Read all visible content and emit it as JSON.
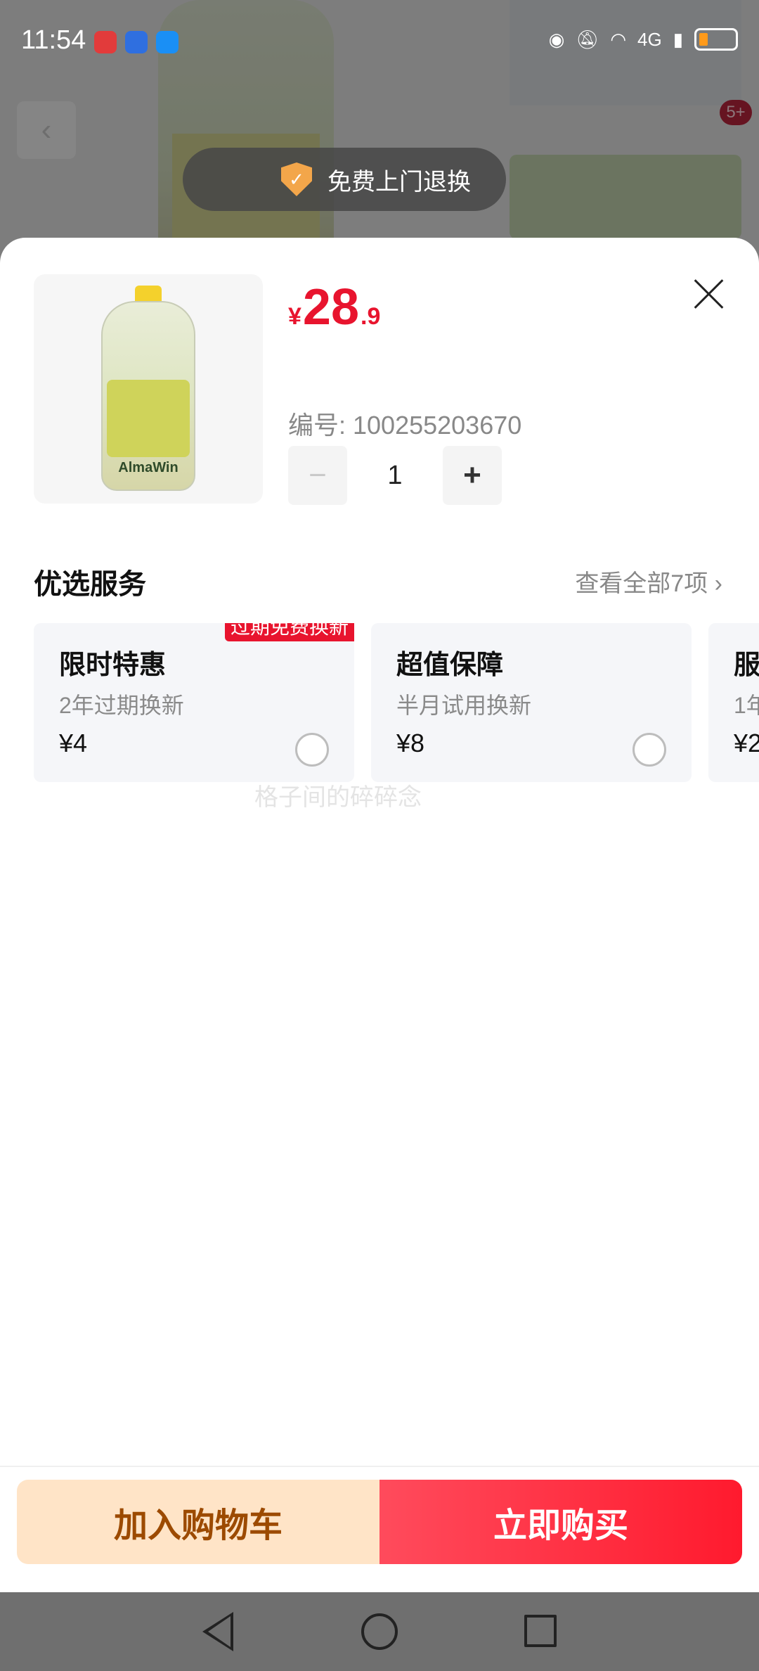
{
  "status_bar": {
    "time": "11:54",
    "network": "4G"
  },
  "background": {
    "banner_text": "免费上门退换",
    "cart_badge": "5+"
  },
  "product": {
    "brand": "AlmaWin",
    "price": {
      "currency": "¥",
      "integer": "28",
      "decimal": ".9"
    },
    "sku_label": "编号: 100255203670",
    "quantity": "1"
  },
  "services": {
    "title": "优选服务",
    "view_all": "查看全部7项 ›",
    "cards": [
      {
        "title": "限时特惠",
        "desc": "2年过期换新",
        "price": "¥4",
        "tag": "过期免费换新"
      },
      {
        "title": "超值保障",
        "desc": "半月试用换新",
        "price": "¥8",
        "tag": ""
      },
      {
        "title": "服",
        "desc": "1年",
        "price": "¥2",
        "tag": ""
      }
    ]
  },
  "watermark": "格子间的碎碎念",
  "actions": {
    "add_to_cart": "加入购物车",
    "buy_now": "立即购买"
  },
  "colors": {
    "price_red": "#e8142e",
    "cart_bg": "#ffe4c7",
    "cart_text": "#9c4a00",
    "buy_bg": "#ff1a2e"
  }
}
